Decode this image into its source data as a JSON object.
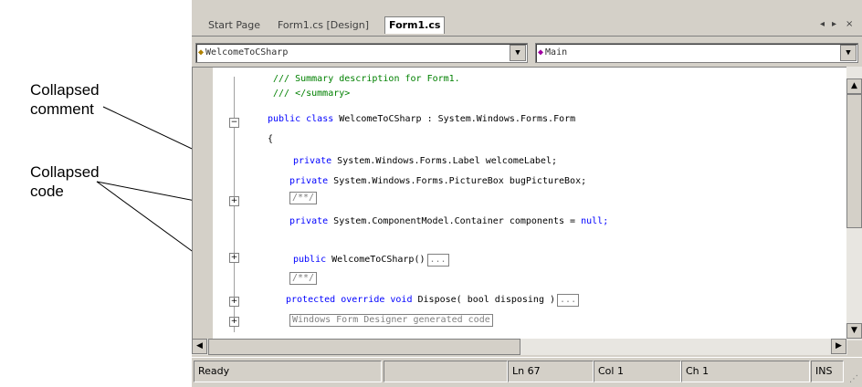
{
  "tabs": [
    "Start Page",
    "Form1.cs [Design]",
    "Form1.cs"
  ],
  "tab_controls": [
    "◂",
    "▸",
    "×"
  ],
  "class_combo": "WelcomeToCSharp",
  "member_combo": "Main",
  "code_lines": {
    "l1": "/// Summary description for Form1.",
    "l2": "/// </summary>",
    "l3_kw": "public class",
    "l3_rest": " WelcomeToCSharp : System.Windows.Forms.Form",
    "l4": "{",
    "l5_kw": "private",
    "l5_rest": " System.Windows.Forms.Label welcomeLabel;",
    "l6_kw": "private",
    "l6_rest": " System.Windows.Forms.PictureBox bugPictureBox;",
    "l7": "/**/",
    "l8_kw": "private",
    "l8_rest": " System.ComponentModel.Container components = ",
    "l8_tail": "null;",
    "l9_kw": "public",
    "l9_rest": " WelcomeToCSharp()",
    "l10": "/**/",
    "l11_kw": "protected override void",
    "l11_rest": " Dispose( bool disposing )",
    "l12": "Windows Form Designer generated code",
    "ellipsis": "..."
  },
  "status": {
    "ready": "Ready",
    "ln": "Ln 67",
    "col": "Col 1",
    "ch": "Ch 1",
    "ins": "INS"
  },
  "callouts": {
    "collapsed_comment": [
      "Collapsed",
      "comment"
    ],
    "collapsed_code": [
      "Collapsed",
      "code"
    ]
  }
}
